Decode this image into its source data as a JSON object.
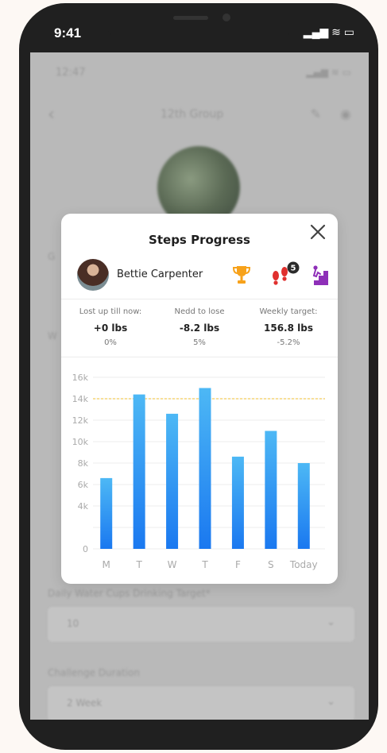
{
  "status_bar": {
    "time": "9:41",
    "icons": "▂▄▆ ≋ ▭"
  },
  "background": {
    "time": "12:47",
    "signal": "▂▄▆ ≋ ▭",
    "back_icon": "‹",
    "title": "12th Group",
    "edit_icon": "✎",
    "eye_icon": "◉",
    "field_label_1": "G",
    "field_label_2": "W",
    "daily_label": "Daily Water Cups Drinking Target*",
    "daily_value": "10",
    "duration_label": "Challenge Duration",
    "duration_value": "2 Week",
    "chevron": "⌄"
  },
  "modal": {
    "title": "Steps Progress",
    "user_name": "Bettie Carpenter",
    "steps_badge_count": "5",
    "stats": [
      {
        "label": "Lost up till now:",
        "value": "+0 lbs",
        "percent": "0%"
      },
      {
        "label": "Nedd to lose",
        "value": "-8.2 lbs",
        "percent": "5%"
      },
      {
        "label": "Weekly target:",
        "value": "156.8 lbs",
        "percent": "-5.2%"
      }
    ]
  },
  "chart_data": {
    "type": "bar",
    "categories": [
      "M",
      "T",
      "W",
      "T",
      "F",
      "S",
      "Today"
    ],
    "values": [
      6600,
      14400,
      12600,
      15000,
      8600,
      11000,
      8000
    ],
    "y_ticks": [
      "0",
      "4k",
      "6k",
      "8k",
      "10k",
      "12k",
      "14k",
      "16k"
    ],
    "ylim": [
      0,
      16000
    ],
    "target_line": 14000,
    "grid": true,
    "colors": {
      "bar_top": "#4db8f5",
      "bar_bottom": "#1a78f0",
      "target_line": "#f2c230",
      "grid": "#eeeeee",
      "tick": "#aaaaaa"
    }
  }
}
